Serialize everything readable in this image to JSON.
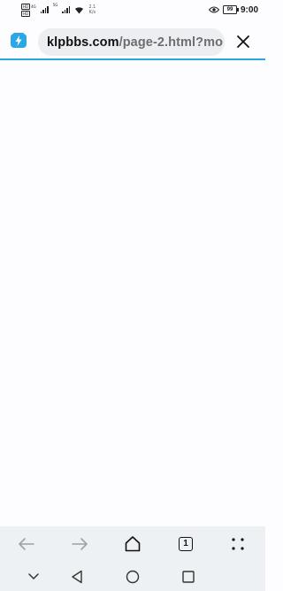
{
  "status_bar": {
    "sim1_chip": "HD",
    "sim1_net": "4G",
    "sim2_chip": "HD",
    "sim2_net": "5G",
    "net_speed_value": "2.1",
    "net_speed_unit": "K/s",
    "battery_level": "99",
    "time": "9:00",
    "icons": [
      "signal-bars-icon",
      "wifi-icon",
      "eye-comfort-icon",
      "battery-icon"
    ]
  },
  "address_bar": {
    "url_domain": "klpbbs.com",
    "url_path": "/page-2.html?mo",
    "accent_color": "#26a9e0",
    "icons": [
      "site-lightning-icon",
      "close-icon"
    ]
  },
  "toolbar": {
    "tab_count": "1",
    "icons": [
      "back-arrow-icon",
      "forward-arrow-icon",
      "home-icon",
      "tabs-icon",
      "more-dots-icon"
    ]
  },
  "system_nav": {
    "icons": [
      "collapse-chevron-icon",
      "nav-back-icon",
      "nav-home-icon",
      "nav-recents-icon"
    ]
  }
}
